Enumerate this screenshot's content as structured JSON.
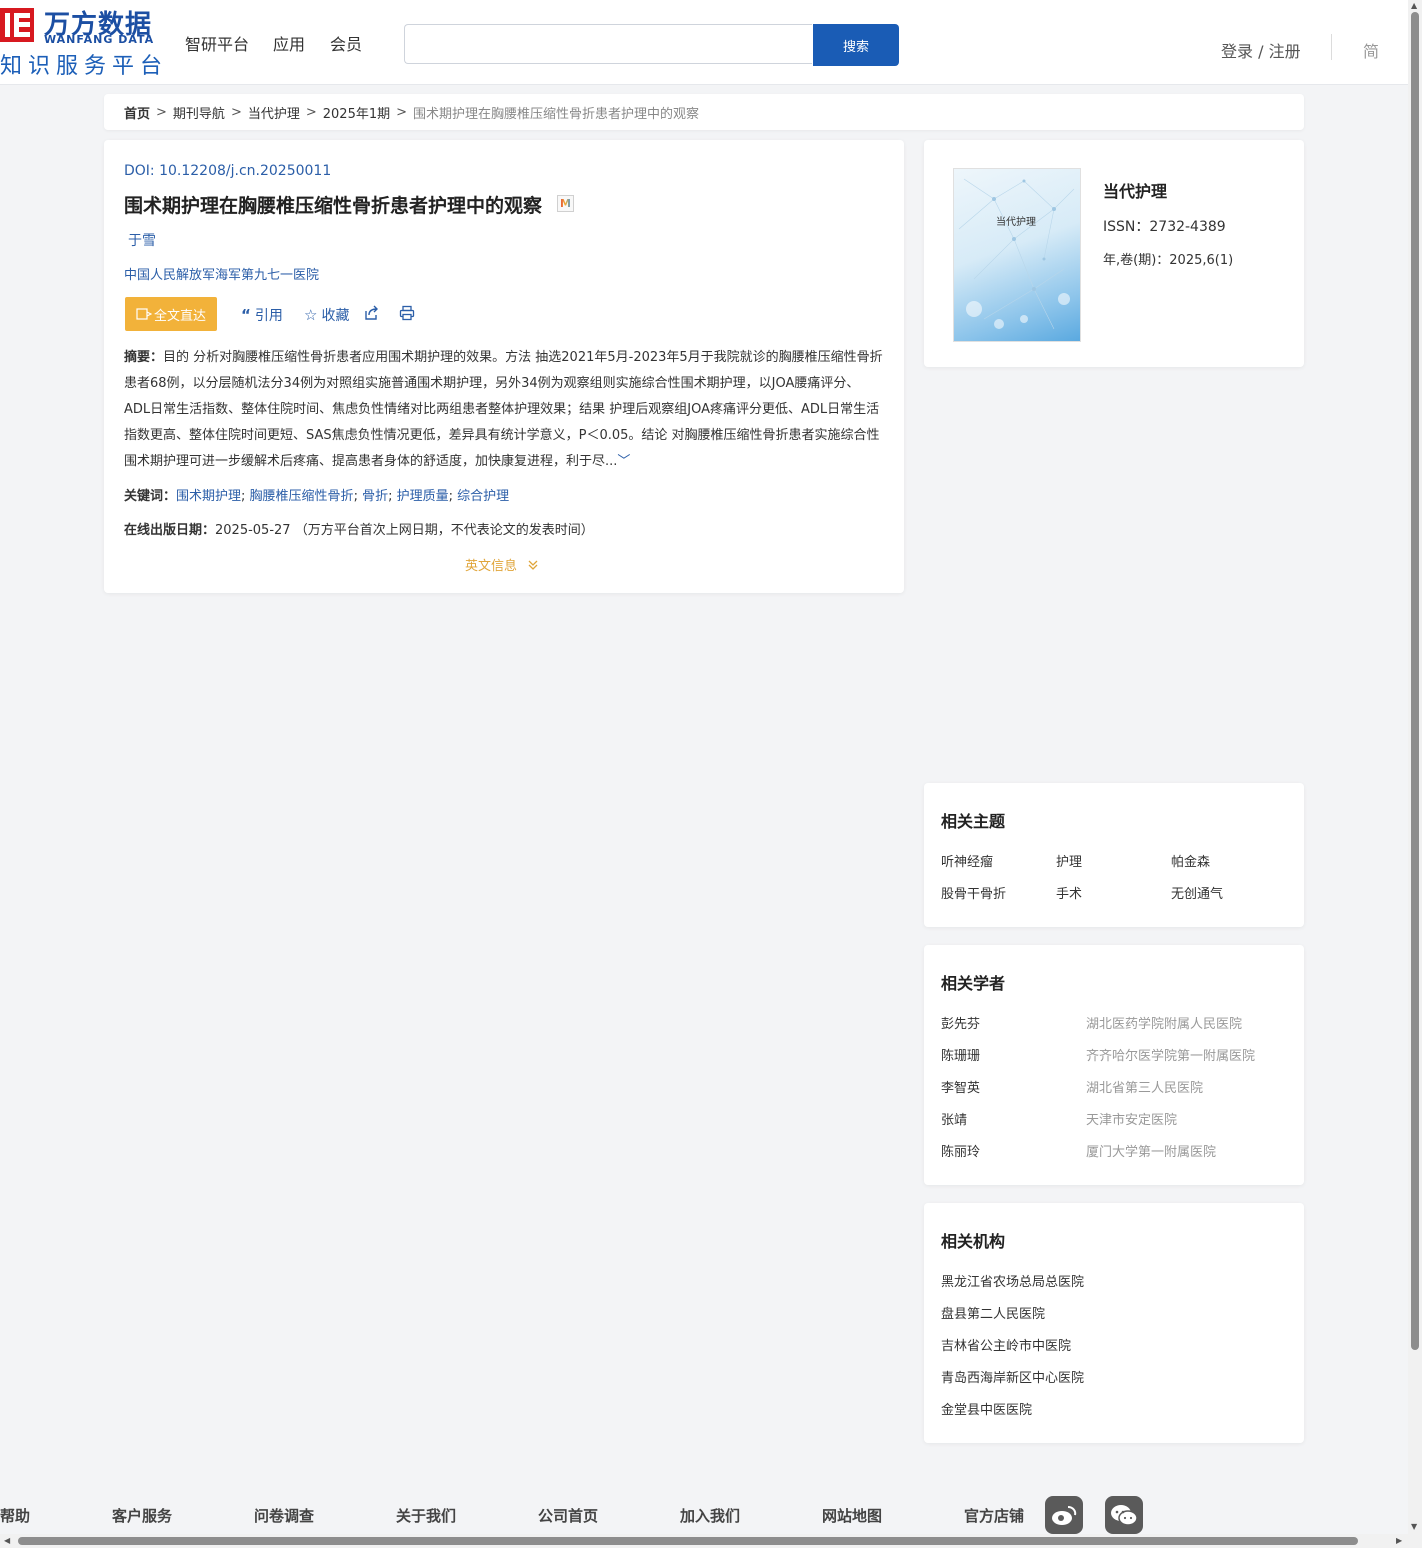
{
  "header": {
    "logo_cn": "万方数据",
    "logo_en": "WANFANG DATA",
    "logo_sub": "知识服务平台",
    "nav": [
      "智研平台",
      "应用",
      "会员"
    ],
    "search_placeholder": "",
    "search_label": "搜索",
    "login_label": "登录 / 注册",
    "lang_label": "简"
  },
  "breadcrumb": {
    "items": [
      "首页",
      "期刊导航",
      "当代护理",
      "2025年1期"
    ],
    "separator": ">",
    "current": "围术期护理在胸腰椎压缩性骨折患者护理中的观察"
  },
  "article": {
    "doi": "DOI: 10.12208/j.cn.20250011",
    "title": "围术期护理在胸腰椎压缩性骨折患者护理中的观察",
    "badge": "M",
    "author": "于雪",
    "affiliation": "中国人民解放军海军第九七一医院",
    "fulltext_label": "全文直达",
    "cite_label": "引用",
    "favorite_label": "收藏",
    "abstract_label": "摘要：",
    "abstract_text": "目的 分析对胸腰椎压缩性骨折患者应用围术期护理的效果。方法 抽选2021年5月-2023年5月于我院就诊的胸腰椎压缩性骨折患者68例，以分层随机法分34例为对照组实施普通围术期护理，另外34例为观察组则实施综合性围术期护理，以JOA腰痛评分、ADL日常生活指数、整体住院时间、焦虑负性情绪对比两组患者整体护理效果；结果 护理后观察组JOA疼痛评分更低、ADL日常生活指数更高、整体住院时间更短、SAS焦虑负性情况更低，差异具有统计学意义，P＜0.05。结论 对胸腰椎压缩性骨折患者实施综合性围术期护理可进一步缓解术后疼痛、提高患者身体的舒适度，加快康复进程，利于尽...",
    "keywords_label": "关键词：",
    "keywords": [
      "围术期护理",
      "胸腰椎压缩性骨折",
      "骨折",
      "护理质量",
      "综合护理"
    ],
    "pubdate_label": "在线出版日期：",
    "pubdate_value": "2025-05-27",
    "pubdate_note": "（万方平台首次上网日期，不代表论文的发表时间）",
    "english_info_label": "英文信息"
  },
  "journal": {
    "cover_title": "当代护理",
    "name": "当代护理",
    "issn": "ISSN：2732-4389",
    "volume": "年,卷(期)：2025,6(1)"
  },
  "related_topics": {
    "title": "相关主题",
    "items": [
      "听神经瘤",
      "护理",
      "帕金森",
      "股骨干骨折",
      "手术",
      "无创通气"
    ]
  },
  "related_scholars": {
    "title": "相关学者",
    "items": [
      {
        "name": "彭先芬",
        "org": "湖北医药学院附属人民医院"
      },
      {
        "name": "陈珊珊",
        "org": "齐齐哈尔医学院第一附属医院"
      },
      {
        "name": "李智英",
        "org": "湖北省第三人民医院"
      },
      {
        "name": "张靖",
        "org": "天津市安定医院"
      },
      {
        "name": "陈丽玲",
        "org": "厦门大学第一附属医院"
      }
    ]
  },
  "related_orgs": {
    "title": "相关机构",
    "items": [
      "黑龙江省农场总局总医院",
      "盘县第二人民医院",
      "吉林省公主岭市中医院",
      "青岛西海岸新区中心医院",
      "金堂县中医医院"
    ]
  },
  "footer": {
    "items": [
      "帮助",
      "客户服务",
      "问卷调查",
      "关于我们",
      "公司首页",
      "加入我们",
      "网站地图",
      "官方店铺"
    ]
  }
}
